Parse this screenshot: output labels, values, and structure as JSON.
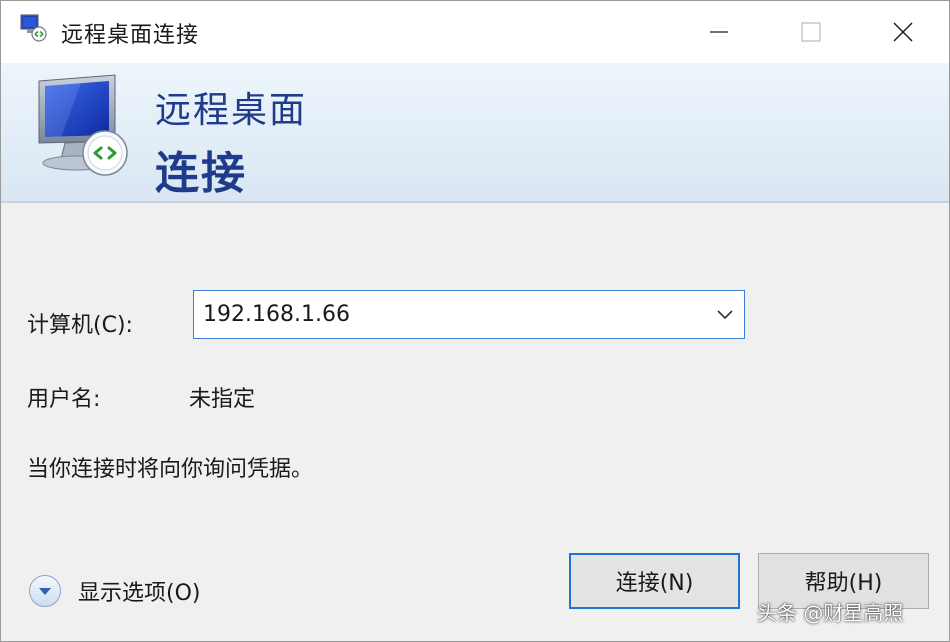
{
  "window": {
    "title": "远程桌面连接",
    "controls": {
      "minimize": "minimize",
      "maximize": "maximize",
      "close": "close"
    }
  },
  "banner": {
    "line1": "远程桌面",
    "line2": "连接"
  },
  "form": {
    "computer_label": "计算机(C):",
    "computer_value": "192.168.1.66",
    "user_label": "用户名:",
    "user_value": "未指定",
    "hint": "当你连接时将向你询问凭据。"
  },
  "footer": {
    "show_options": "显示选项(O)",
    "connect": "连接(N)",
    "help": "帮助(H)"
  },
  "watermark": "头条 @财星高照",
  "icons": [
    "remote-desktop-icon",
    "monitor-icon",
    "chevron-down-icon",
    "minimize-icon",
    "maximize-icon",
    "close-icon"
  ],
  "colors": {
    "accent": "#1f73d3",
    "banner_text": "#1f3c8a",
    "input_border": "#3c7fd6"
  }
}
